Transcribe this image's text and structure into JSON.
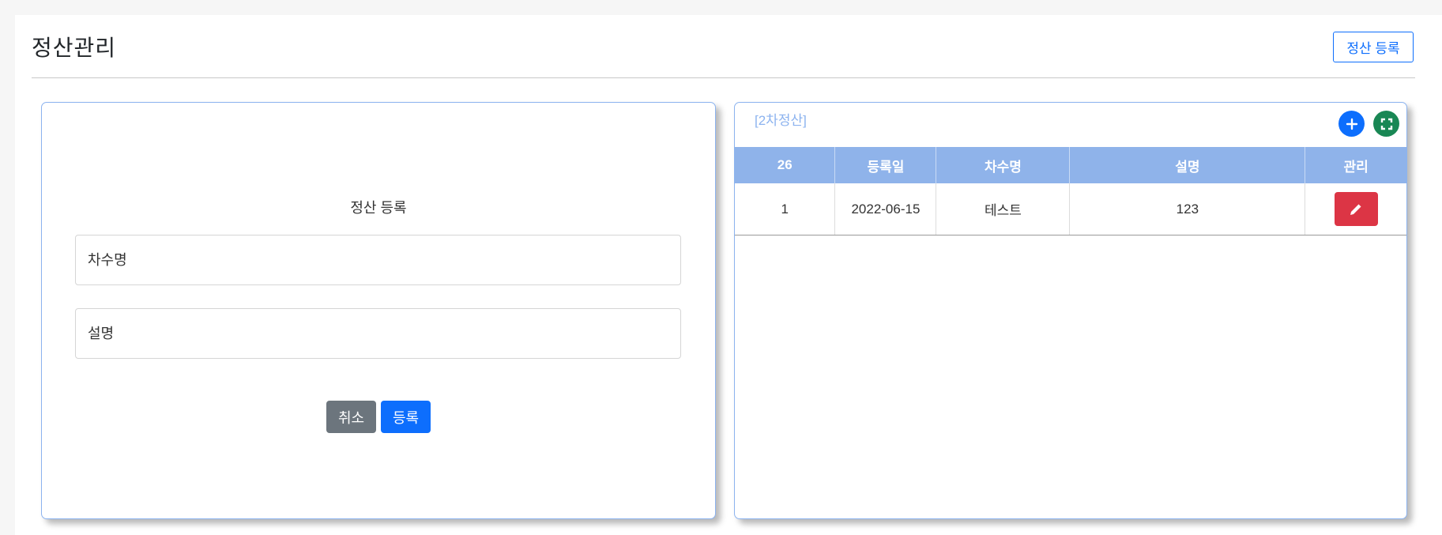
{
  "header": {
    "title": "정산관리",
    "register_button": "정산 등록"
  },
  "form": {
    "title": "정산 등록",
    "round_name_placeholder": "차수명",
    "description_placeholder": "설명",
    "cancel_label": "취소",
    "submit_label": "등록"
  },
  "table_panel": {
    "caption": "[2차정산]",
    "add_icon": "plus-icon",
    "expand_icon": "fullscreen-icon",
    "columns": [
      "26",
      "등록일",
      "차수명",
      "설명",
      "관리"
    ],
    "rows": [
      {
        "no": "1",
        "date": "2022-06-15",
        "name": "테스트",
        "description": "123",
        "action_icon": "pencil-icon"
      }
    ]
  },
  "colors": {
    "primary": "#0d6efd",
    "secondary": "#6c757d",
    "success": "#198754",
    "danger": "#dc3545",
    "header_blue": "#8fb3ea",
    "card_border": "#8cb3ef"
  }
}
